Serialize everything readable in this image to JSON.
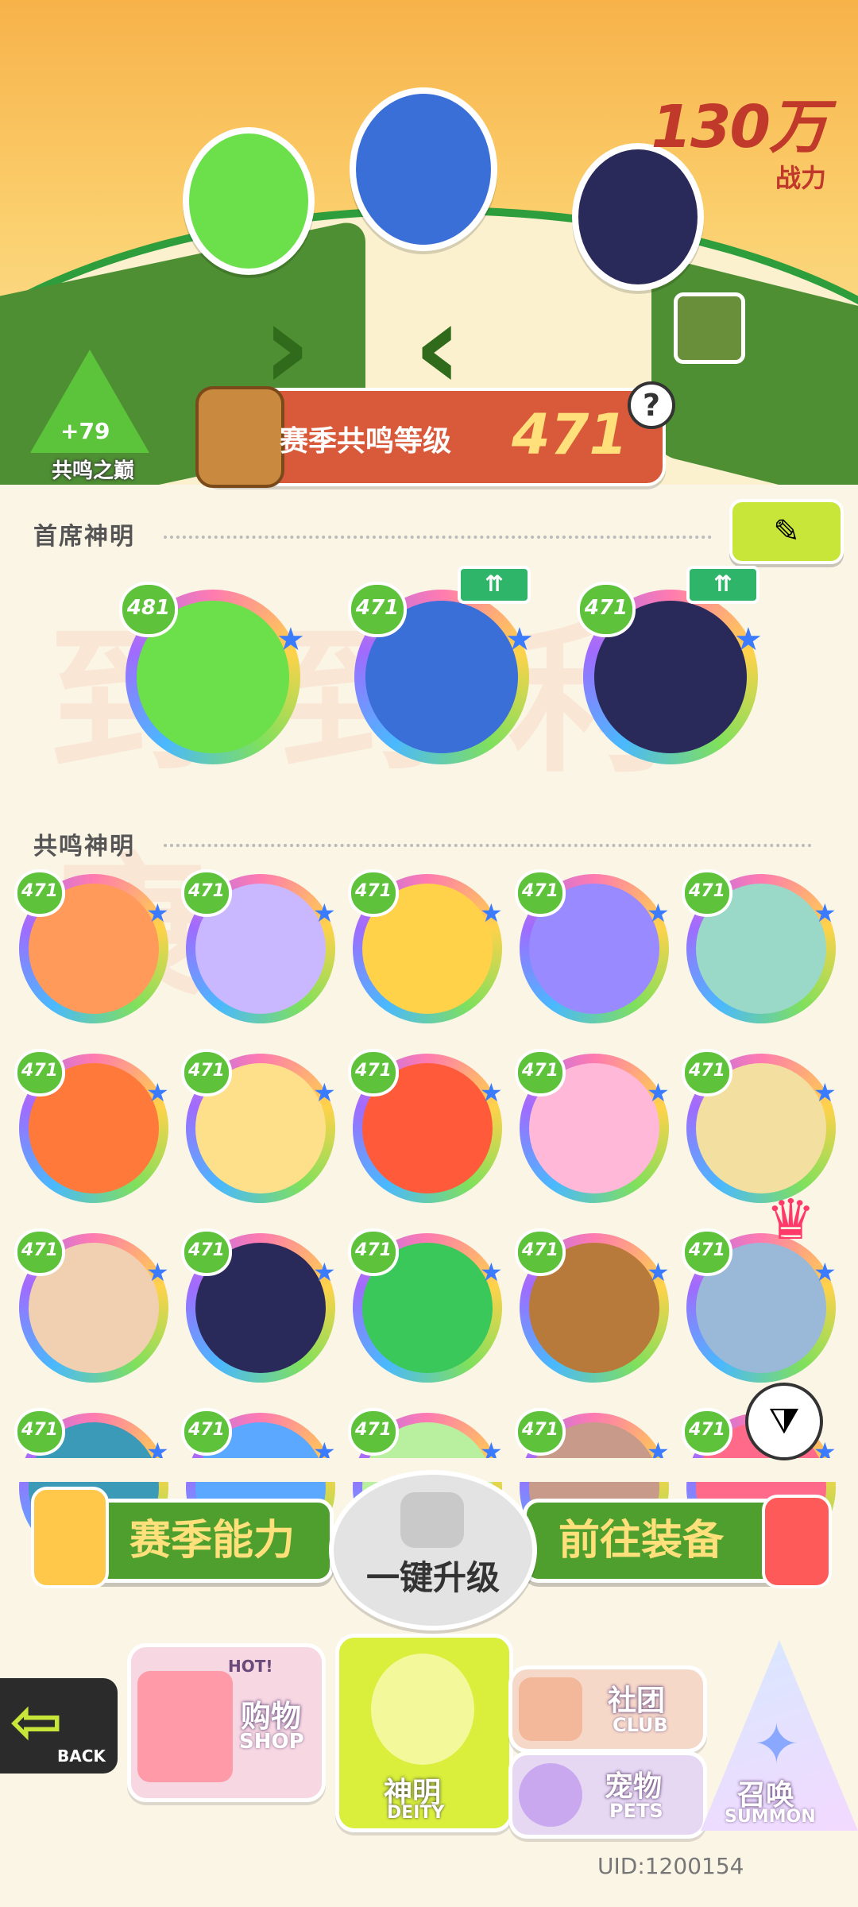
{
  "header": {
    "power_value": "130万",
    "power_label": "战力",
    "peak_bonus": "+79",
    "peak_name": "共鸣之巅",
    "season_level_label": "赛季共鸣等级",
    "season_level_value": "471",
    "help_symbol": "?"
  },
  "sections": {
    "chief_title": "首席神明",
    "resonance_title": "共鸣神明",
    "watermark": "到 到 利 康"
  },
  "chief_deities": [
    {
      "level": "481",
      "upgradable": false,
      "ring": "#ffd24a"
    },
    {
      "level": "471",
      "upgradable": true,
      "ring": "#4ab8ff"
    },
    {
      "level": "471",
      "upgradable": true,
      "ring": "#a06bff"
    }
  ],
  "resonance_deities": [
    {
      "level": "471"
    },
    {
      "level": "471"
    },
    {
      "level": "471"
    },
    {
      "level": "471"
    },
    {
      "level": "471"
    },
    {
      "level": "471"
    },
    {
      "level": "471"
    },
    {
      "level": "471"
    },
    {
      "level": "471"
    },
    {
      "level": "471"
    },
    {
      "level": "471"
    },
    {
      "level": "471"
    },
    {
      "level": "471"
    },
    {
      "level": "471"
    },
    {
      "level": "471"
    },
    {
      "level": "471"
    },
    {
      "level": "471"
    },
    {
      "level": "471"
    },
    {
      "level": "471"
    },
    {
      "level": "471"
    }
  ],
  "icons": {
    "up_arrows": "⇈",
    "edit": "✎",
    "filter": "⧩",
    "back_arrow": "⇦"
  },
  "actions": {
    "season_ability": "赛季能力",
    "one_click_upgrade": "一键升级",
    "go_equipment": "前往装备"
  },
  "nav": {
    "back": "BACK",
    "shop_cn": "购物",
    "shop_en": "SHOP",
    "shop_badge": "HOT!",
    "deity_cn": "神明",
    "deity_en": "DEITY",
    "club_cn": "社团",
    "club_en": "CLUB",
    "pets_cn": "宠物",
    "pets_en": "PETS",
    "summon_cn": "召唤",
    "summon_en": "SUMMON"
  },
  "uid": "UID:1200154",
  "colors": {
    "accent_green": "#4f9f2f",
    "level_badge_green": "#5ec23a",
    "banner_red": "#d85a3a",
    "power_red": "#c0392b"
  }
}
